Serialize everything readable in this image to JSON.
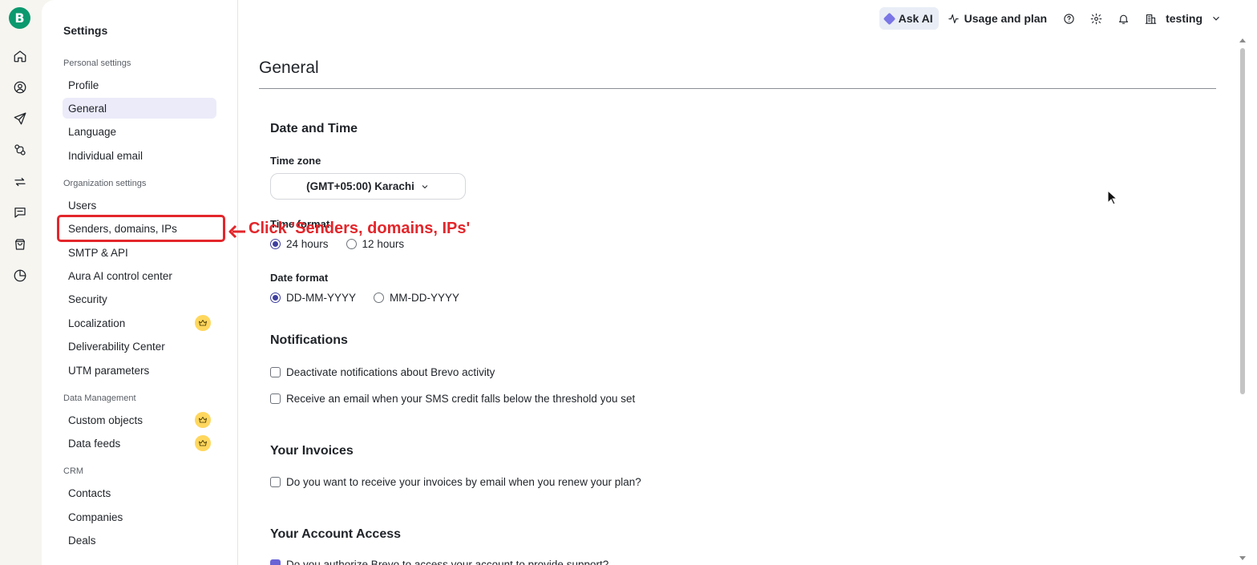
{
  "rail": {
    "logo_letter": "B",
    "icons": [
      "home-icon",
      "contacts-icon",
      "send-icon",
      "automations-icon",
      "transactional-icon",
      "conversations-icon",
      "commerce-icon",
      "reports-icon"
    ]
  },
  "sidebar": {
    "title": "Settings",
    "sections": {
      "personal": "Personal settings",
      "organization": "Organization settings",
      "data": "Data Management",
      "crm": "CRM"
    },
    "items": {
      "profile": "Profile",
      "general": "General",
      "language": "Language",
      "individual_email": "Individual email",
      "users": "Users",
      "senders": "Senders, domains, IPs",
      "smtp": "SMTP & API",
      "aura": "Aura AI control center",
      "security": "Security",
      "localization": "Localization",
      "deliverability": "Deliverability Center",
      "utm": "UTM parameters",
      "custom_objects": "Custom objects",
      "data_feeds": "Data feeds",
      "contacts": "Contacts",
      "companies": "Companies",
      "deals": "Deals"
    }
  },
  "topbar": {
    "ask_ai": "Ask AI",
    "usage": "Usage and plan",
    "account": "testing"
  },
  "main": {
    "title": "General",
    "date_time": {
      "heading": "Date and Time",
      "timezone_label": "Time zone",
      "timezone_value": "(GMT+05:00) Karachi",
      "time_format_label": "Time format",
      "time_24": "24 hours",
      "time_12": "12 hours",
      "time_selected": "24 hours",
      "date_format_label": "Date format",
      "date_dmy": "DD-MM-YYYY",
      "date_mdy": "MM-DD-YYYY",
      "date_selected": "DD-MM-YYYY"
    },
    "notifications": {
      "heading": "Notifications",
      "deactivate": "Deactivate notifications about Brevo activity",
      "sms_credit": "Receive an email when your SMS credit falls below the threshold you set"
    },
    "invoices": {
      "heading": "Your Invoices",
      "receive": "Do you want to receive your invoices by email when you renew your plan?"
    },
    "account_access": {
      "heading": "Your Account Access",
      "authorize": "Do you authorize Brevo to access your account to provide support?"
    }
  },
  "annotation": {
    "text": "Click 'Senders, domains, IPs'",
    "color": "#e3262b"
  },
  "colors": {
    "brand": "#0b996e",
    "active_bg": "#ebebfa",
    "radio_selected": "#3f3f9f",
    "premium_badge": "#ffd75e"
  }
}
